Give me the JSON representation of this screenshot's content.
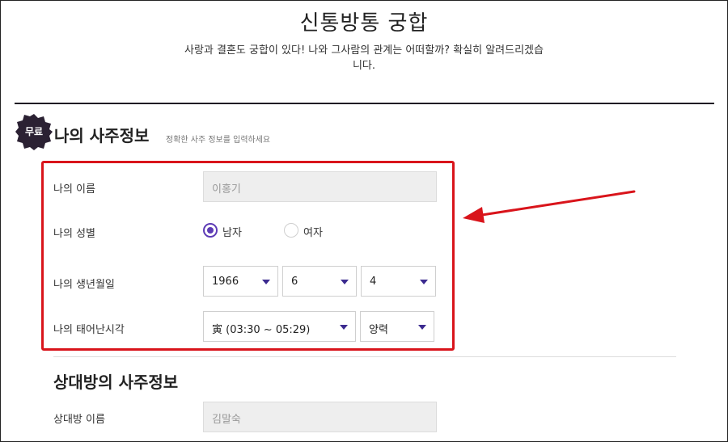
{
  "header": {
    "title": "신통방통 궁합",
    "subtitle": "사랑과 결혼도 궁합이 있다! 나와 그사람의 관계는 어떠할까? 확실히 알려드리겠습니다."
  },
  "my_section": {
    "badge": "무료",
    "title": "나의 사주정보",
    "hint": "정확한 사주 정보를 입력하세요",
    "name_label": "나의 이름",
    "name_value": "이홍기",
    "gender_label": "나의 성별",
    "gender_male": "남자",
    "gender_female": "여자",
    "gender_selected": "남자",
    "birth_label": "나의 생년월일",
    "birth_year": "1966",
    "birth_month": "6",
    "birth_day": "4",
    "time_label": "나의 태어난시각",
    "birth_time": "寅 (03:30 ~ 05:29)",
    "calendar": "양력"
  },
  "partner_section": {
    "title": "상대방의 사주정보",
    "name_label": "상대방 이름",
    "name_value": "김말숙"
  },
  "colors": {
    "accent": "#5d3bb5",
    "annotation_red": "#d9141b",
    "badge_bg": "#2b2133"
  }
}
